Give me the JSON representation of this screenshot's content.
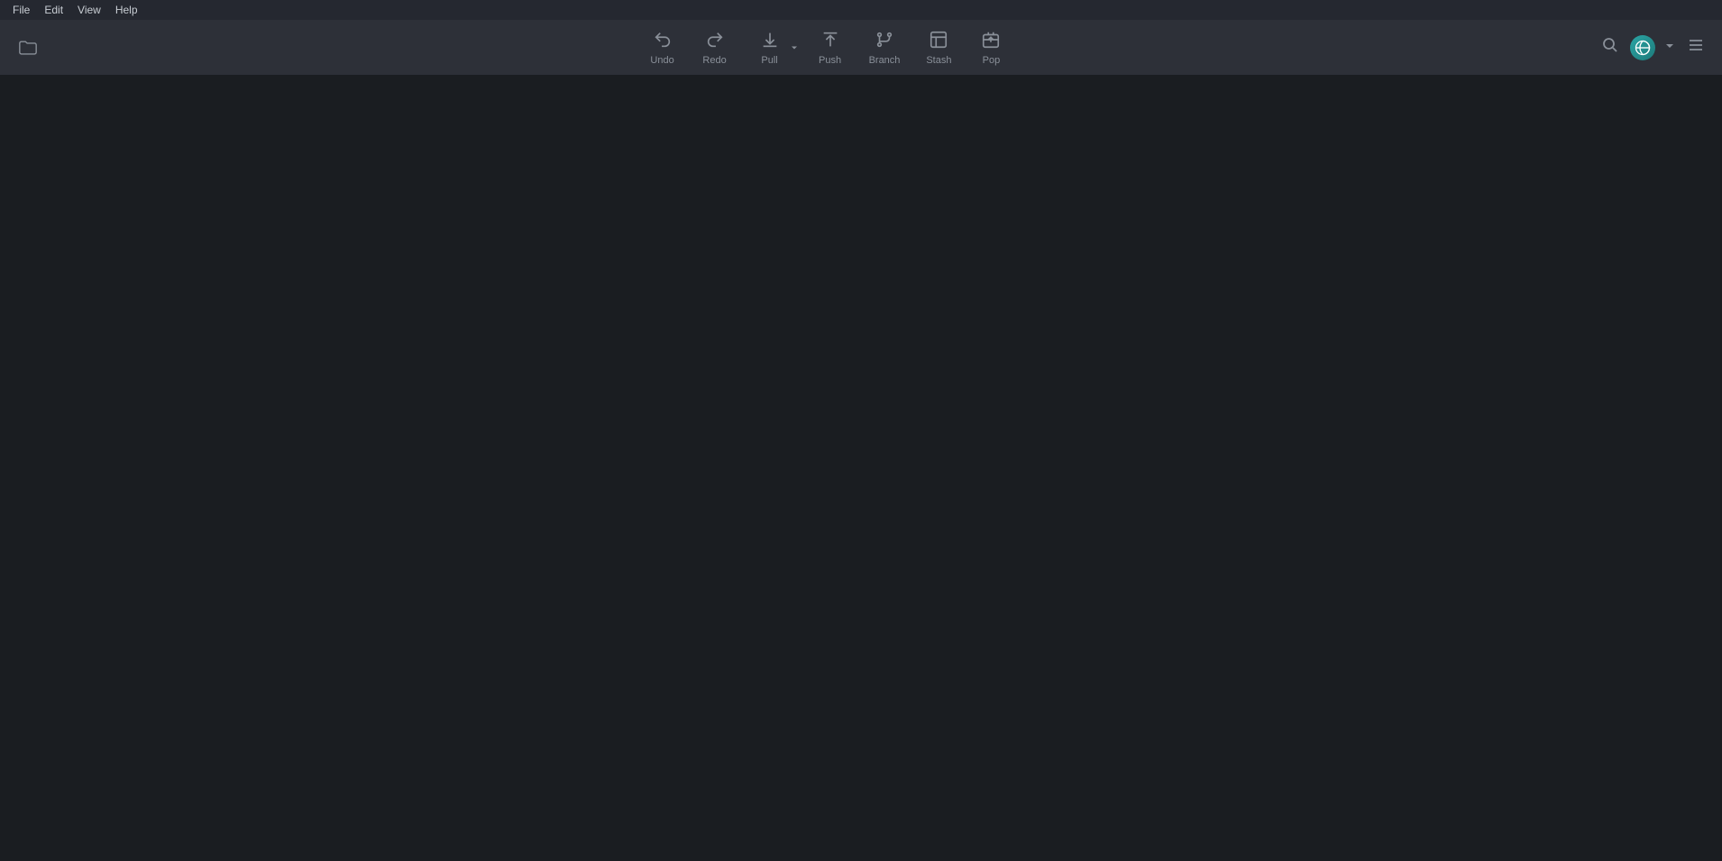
{
  "menubar": {
    "items": [
      {
        "id": "file",
        "label": "File"
      },
      {
        "id": "edit",
        "label": "Edit"
      },
      {
        "id": "view",
        "label": "View"
      },
      {
        "id": "help",
        "label": "Help"
      }
    ]
  },
  "toolbar": {
    "folder_icon": "folder",
    "buttons": [
      {
        "id": "undo",
        "label": "Undo",
        "icon": "undo"
      },
      {
        "id": "redo",
        "label": "Redo",
        "icon": "redo"
      },
      {
        "id": "pull",
        "label": "Pull",
        "icon": "pull",
        "has_arrow": true
      },
      {
        "id": "push",
        "label": "Push",
        "icon": "push"
      },
      {
        "id": "branch",
        "label": "Branch",
        "icon": "branch"
      },
      {
        "id": "stash",
        "label": "Stash",
        "icon": "stash"
      },
      {
        "id": "pop",
        "label": "Pop",
        "icon": "pop"
      }
    ]
  },
  "right_controls": {
    "search_label": "Search",
    "avatar_label": "User Avatar",
    "dropdown_label": "Account Dropdown",
    "menu_label": "Menu"
  },
  "main": {
    "background_color": "#1a1d21"
  }
}
